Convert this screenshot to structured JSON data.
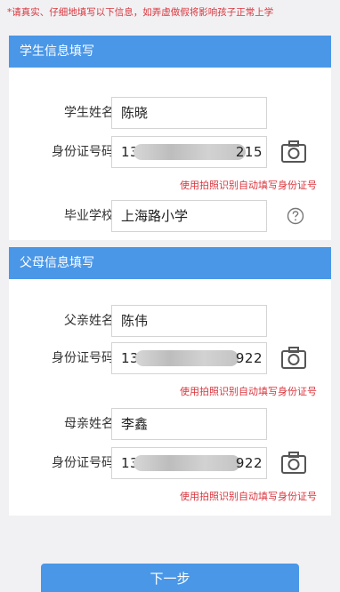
{
  "notice": "*请真实、仔细地填写以下信息，如弄虚做假将影响孩子正常上学",
  "student_section": {
    "title": "学生信息填写",
    "name_label": "学生姓名",
    "name_value": "陈晓",
    "id_label": "身份证号码",
    "id_prefix": "13",
    "id_suffix": "215",
    "ocr_hint": "使用拍照识别自动填写身份证号",
    "school_label": "毕业学校",
    "school_value": "上海路小学"
  },
  "parent_section": {
    "title": "父母信息填写",
    "father_label": "父亲姓名",
    "father_value": "陈伟",
    "father_id_label": "身份证号码",
    "father_id_prefix": "13",
    "father_id_suffix": "922",
    "father_ocr_hint": "使用拍照识别自动填写身份证号",
    "mother_label": "母亲姓名",
    "mother_value": "李鑫",
    "mother_id_label": "身份证号码",
    "mother_id_prefix": "13",
    "mother_id_suffix": "922",
    "mother_ocr_hint": "使用拍照识别自动填写身份证号"
  },
  "next_button": "下一步",
  "colors": {
    "accent": "#4a97e8",
    "warning": "#d9363e",
    "background": "#f1f1f3"
  },
  "icons": {
    "camera": "camera-icon",
    "help": "help-circle-icon"
  }
}
